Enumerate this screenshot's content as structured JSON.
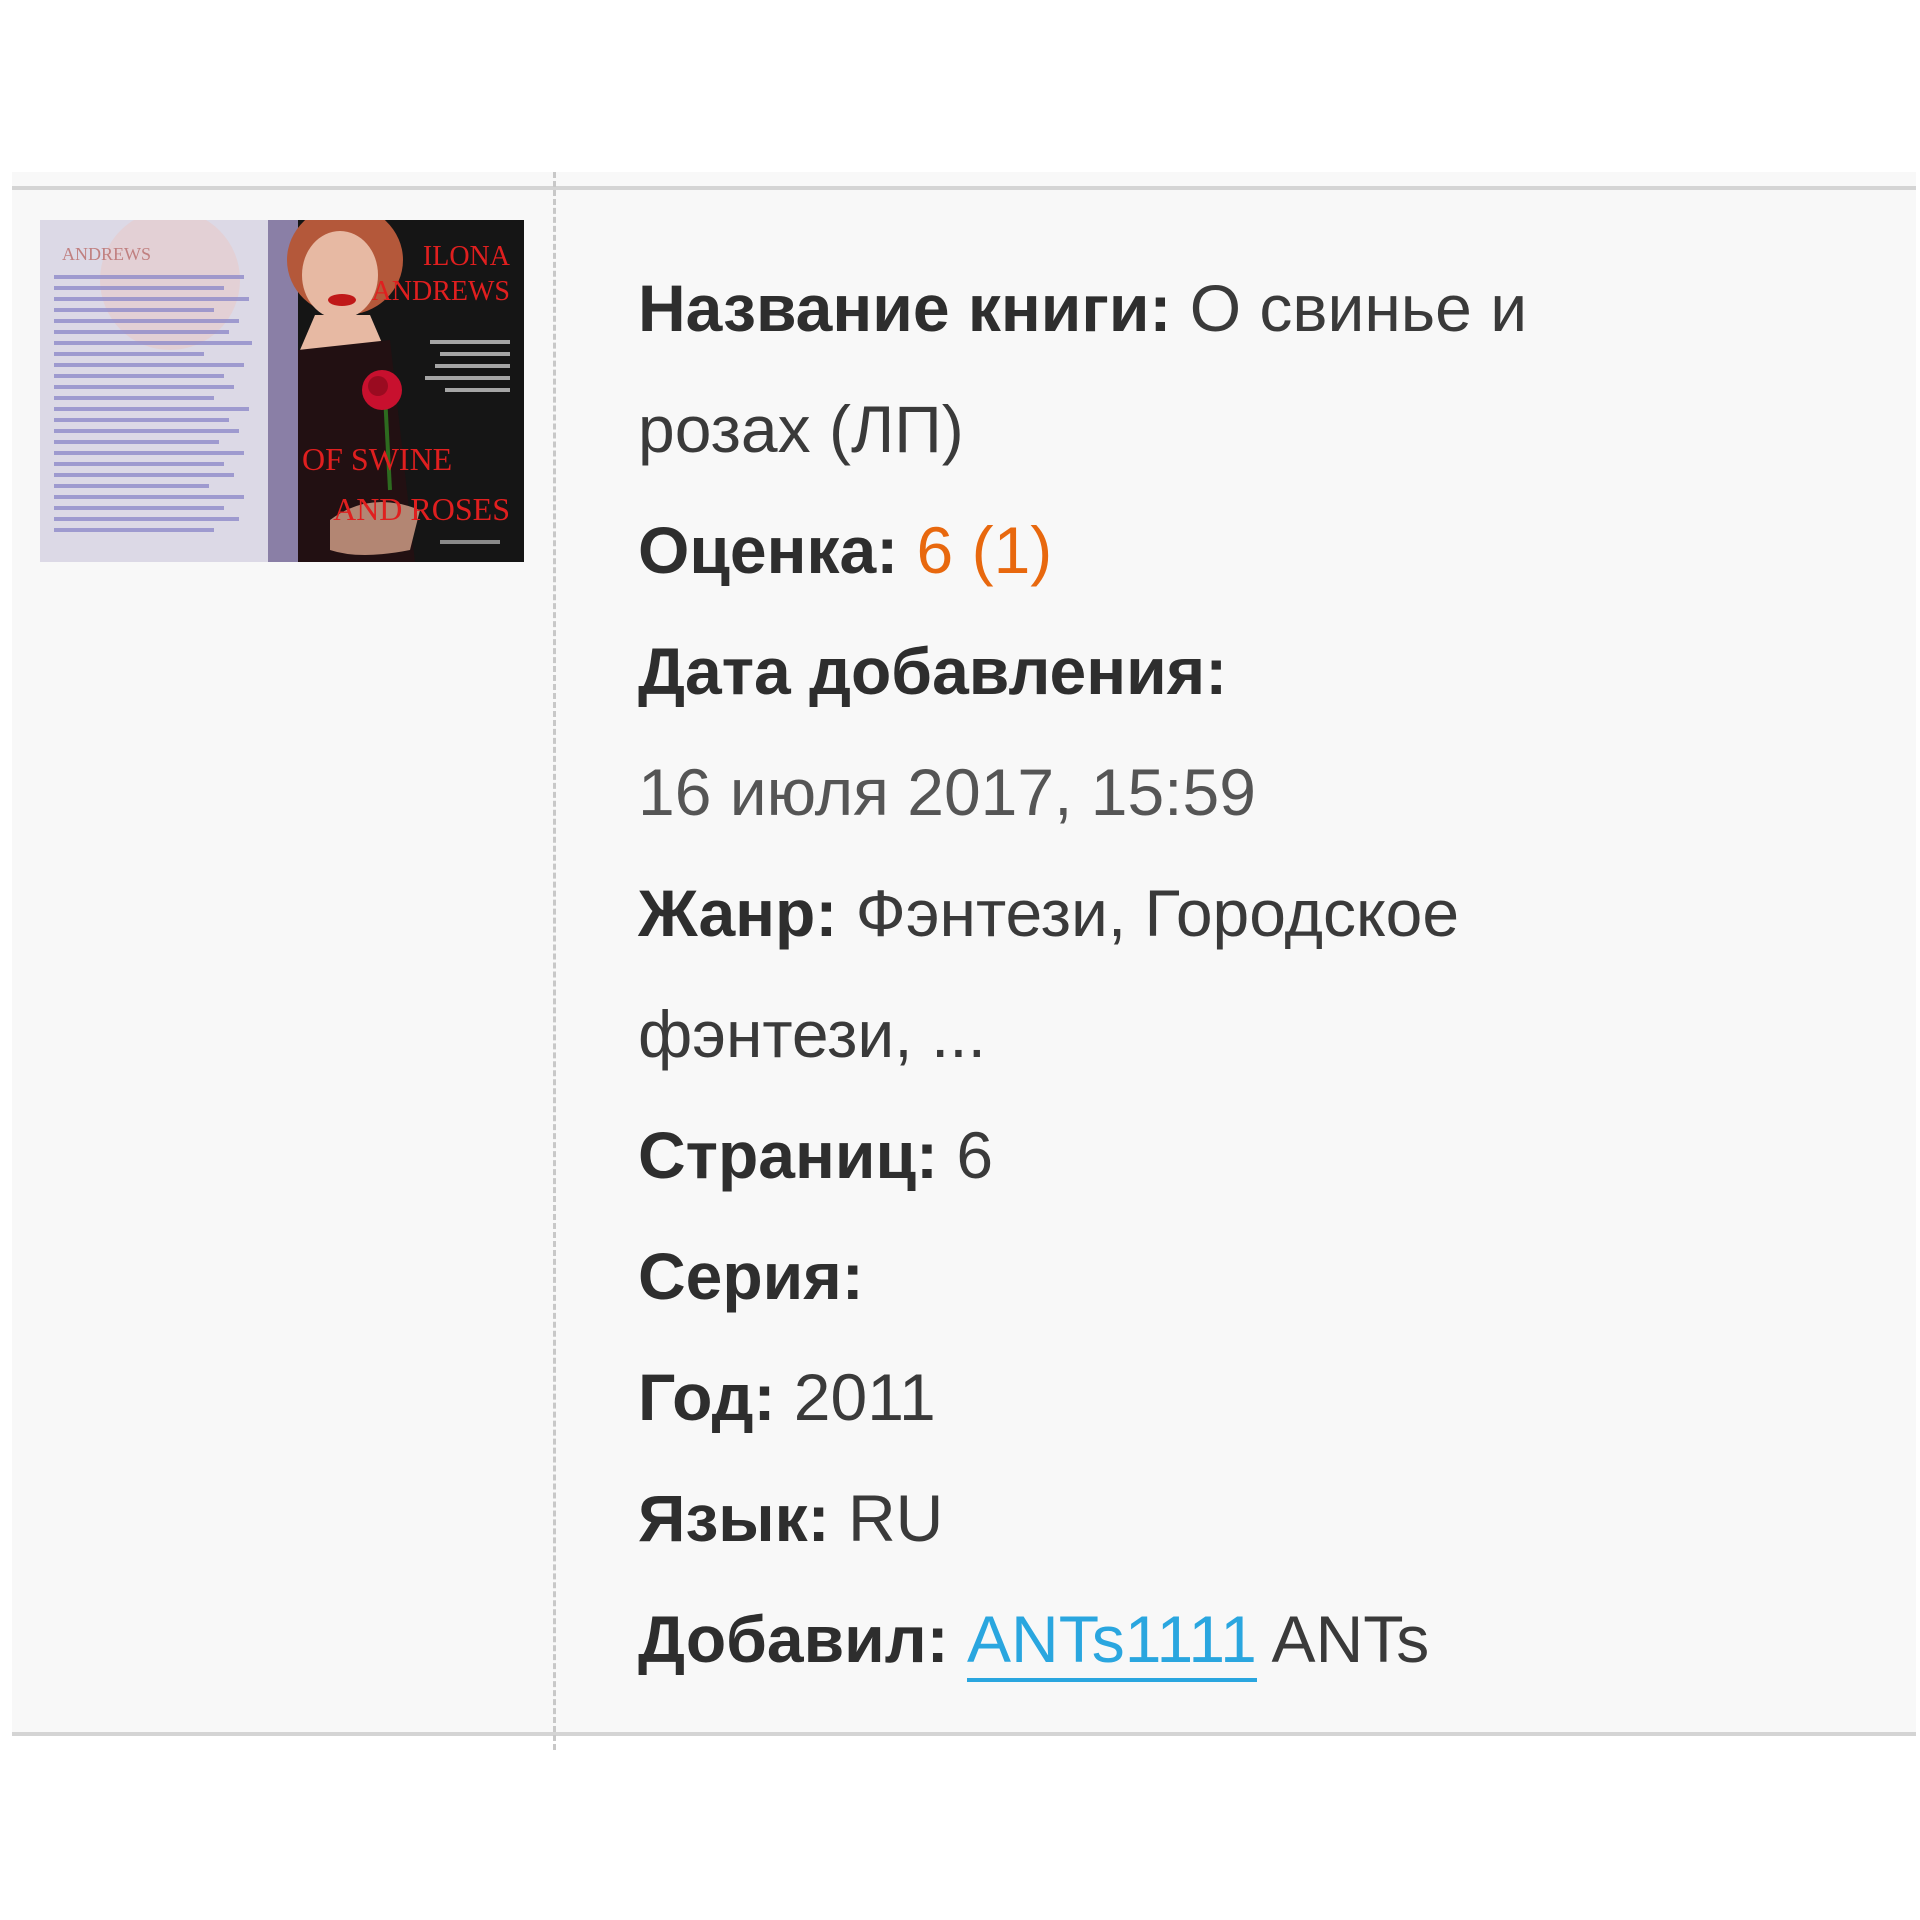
{
  "book": {
    "title_label": "Название книги:",
    "title_line1": "О свинье и",
    "title_line2": "розах (ЛП)",
    "rating_label": "Оценка:",
    "rating_value": "6 (1)",
    "date_label": "Дата добавления:",
    "date_value": "16 июля 2017, 15:59",
    "genre_label": "Жанр:",
    "genre_line1": "Фэнтези, Городское",
    "genre_line2": "фэнтези, ...",
    "pages_label": "Страниц:",
    "pages_value": "6",
    "series_label": "Серия:",
    "year_label": "Год:",
    "year_value": "2011",
    "language_label": "Язык:",
    "language_value": "RU",
    "added_by_label": "Добавил:",
    "added_by_link": "ANTs1111",
    "added_by_name": "ANTs"
  },
  "cover": {
    "author_line1": "ILONA",
    "author_line2": "ANDREWS",
    "title_line1": "OF SWINE",
    "title_line2": "AND ROSES",
    "back_heading": "ANDREWS",
    "accent_color": "#d81e1e",
    "background_color": "#151515"
  },
  "colors": {
    "rating": "#e8680e",
    "link": "#2aa6df"
  }
}
